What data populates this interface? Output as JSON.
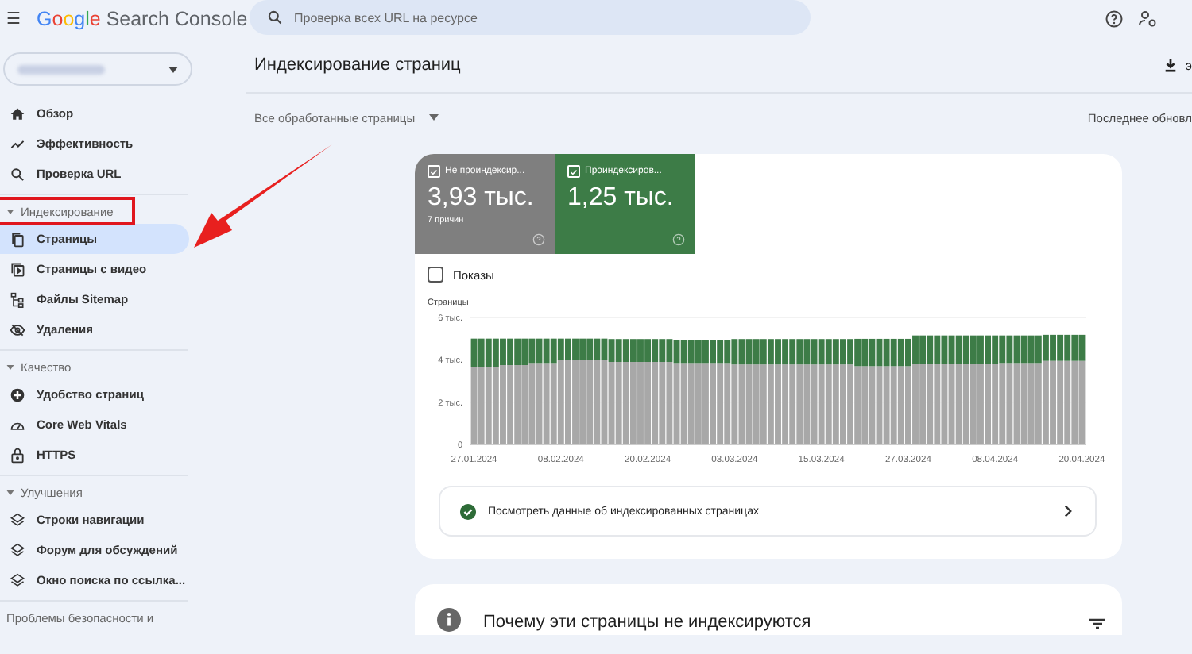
{
  "header": {
    "menu_icon": "☰",
    "logo": {
      "brand": "Google",
      "product": "Search Console"
    },
    "search": {
      "placeholder": "Проверка всех URL на ресурсе"
    }
  },
  "sidebar": {
    "items": [
      {
        "label": "Обзор",
        "selected": false
      },
      {
        "label": "Эффективность",
        "selected": false
      },
      {
        "label": "Проверка URL",
        "selected": false
      }
    ],
    "sections": [
      {
        "title": "Индексирование",
        "expanded": true,
        "highlighted": true,
        "items": [
          {
            "label": "Страницы",
            "selected": true
          },
          {
            "label": "Страницы с видео",
            "selected": false
          },
          {
            "label": "Файлы Sitemap",
            "selected": false
          },
          {
            "label": "Удаления",
            "selected": false
          }
        ]
      },
      {
        "title": "Качество",
        "expanded": true,
        "highlighted": false,
        "items": [
          {
            "label": "Удобство страниц",
            "selected": false
          },
          {
            "label": "Core Web Vitals",
            "selected": false
          },
          {
            "label": "HTTPS",
            "selected": false
          }
        ]
      },
      {
        "title": "Улучшения",
        "expanded": true,
        "highlighted": false,
        "items": [
          {
            "label": "Строки навигации",
            "selected": false
          },
          {
            "label": "Форум для обсуждений",
            "selected": false
          },
          {
            "label": "Окно поиска по ссылка...",
            "selected": false
          }
        ]
      },
      {
        "title": "Проблемы безопасности и",
        "highlighted": false
      }
    ]
  },
  "page": {
    "title": "Индексирование страниц",
    "export_label": "э",
    "filter": "Все обработанные страницы",
    "last_update": "Последнее обновл"
  },
  "summary": {
    "tiles": [
      {
        "label": "Не проиндексир...",
        "value": "3,93 тыс.",
        "note": "7 причин",
        "checked": true,
        "color": "#7f7f7f"
      },
      {
        "label": "Проиндексиров...",
        "value": "1,25 тыс.",
        "checked": true,
        "color": "#3d7c47"
      }
    ],
    "impressions": {
      "label": "Показы",
      "checked": false
    },
    "chart_data": {
      "type": "bar",
      "stacked": true,
      "ylabel": "Страницы",
      "ylim": [
        0,
        6
      ],
      "yticks": [
        {
          "value": 0,
          "label": "0"
        },
        {
          "value": 2,
          "label": "2 тыс."
        },
        {
          "value": 4,
          "label": "4 тыс."
        },
        {
          "value": 6,
          "label": "6 тыс."
        }
      ],
      "categories": [
        "27.01.2024",
        null,
        null,
        null,
        null,
        null,
        null,
        null,
        null,
        null,
        null,
        null,
        "08.02.2024",
        null,
        null,
        null,
        null,
        null,
        null,
        null,
        null,
        null,
        null,
        null,
        "20.02.2024",
        null,
        null,
        null,
        null,
        null,
        null,
        null,
        null,
        null,
        null,
        null,
        "03.03.2024",
        null,
        null,
        null,
        null,
        null,
        null,
        null,
        null,
        null,
        null,
        null,
        "15.03.2024",
        null,
        null,
        null,
        null,
        null,
        null,
        null,
        null,
        null,
        null,
        null,
        "27.03.2024",
        null,
        null,
        null,
        null,
        null,
        null,
        null,
        null,
        null,
        null,
        null,
        "08.04.2024",
        null,
        null,
        null,
        null,
        null,
        null,
        null,
        null,
        null,
        null,
        null,
        "20.04.2024"
      ],
      "series": [
        {
          "color": "#a8a8a8",
          "values": [
            3.65,
            3.65,
            3.65,
            3.65,
            3.75,
            3.75,
            3.75,
            3.75,
            3.85,
            3.85,
            3.85,
            3.85,
            3.98,
            3.98,
            3.98,
            3.98,
            3.98,
            3.98,
            3.98,
            3.9,
            3.9,
            3.9,
            3.9,
            3.9,
            3.9,
            3.9,
            3.9,
            3.9,
            3.85,
            3.85,
            3.85,
            3.85,
            3.85,
            3.85,
            3.85,
            3.85,
            3.78,
            3.78,
            3.78,
            3.78,
            3.78,
            3.78,
            3.78,
            3.78,
            3.78,
            3.78,
            3.78,
            3.78,
            3.78,
            3.78,
            3.78,
            3.78,
            3.78,
            3.7,
            3.7,
            3.7,
            3.7,
            3.7,
            3.7,
            3.7,
            3.7,
            3.82,
            3.82,
            3.82,
            3.82,
            3.82,
            3.82,
            3.82,
            3.82,
            3.82,
            3.82,
            3.82,
            3.82,
            3.85,
            3.85,
            3.85,
            3.85,
            3.85,
            3.85,
            3.95,
            3.95,
            3.95,
            3.95,
            3.95,
            3.95
          ]
        },
        {
          "color": "#3d7c47",
          "values": [
            1.35,
            1.35,
            1.35,
            1.35,
            1.25,
            1.25,
            1.25,
            1.25,
            1.15,
            1.15,
            1.15,
            1.15,
            1.02,
            1.02,
            1.02,
            1.02,
            1.02,
            1.02,
            1.02,
            1.08,
            1.08,
            1.08,
            1.08,
            1.08,
            1.08,
            1.08,
            1.08,
            1.08,
            1.1,
            1.1,
            1.1,
            1.1,
            1.1,
            1.1,
            1.1,
            1.1,
            1.2,
            1.2,
            1.2,
            1.2,
            1.2,
            1.2,
            1.2,
            1.2,
            1.2,
            1.2,
            1.2,
            1.2,
            1.2,
            1.2,
            1.2,
            1.2,
            1.2,
            1.29,
            1.29,
            1.29,
            1.29,
            1.29,
            1.29,
            1.29,
            1.29,
            1.33,
            1.33,
            1.33,
            1.33,
            1.33,
            1.33,
            1.33,
            1.33,
            1.33,
            1.33,
            1.33,
            1.33,
            1.3,
            1.3,
            1.3,
            1.3,
            1.3,
            1.3,
            1.23,
            1.23,
            1.23,
            1.23,
            1.23,
            1.23
          ]
        }
      ]
    },
    "link": "Посмотреть данные об индексированных страницах"
  },
  "reasons": {
    "title": "Почему эти страницы не индексируются"
  }
}
